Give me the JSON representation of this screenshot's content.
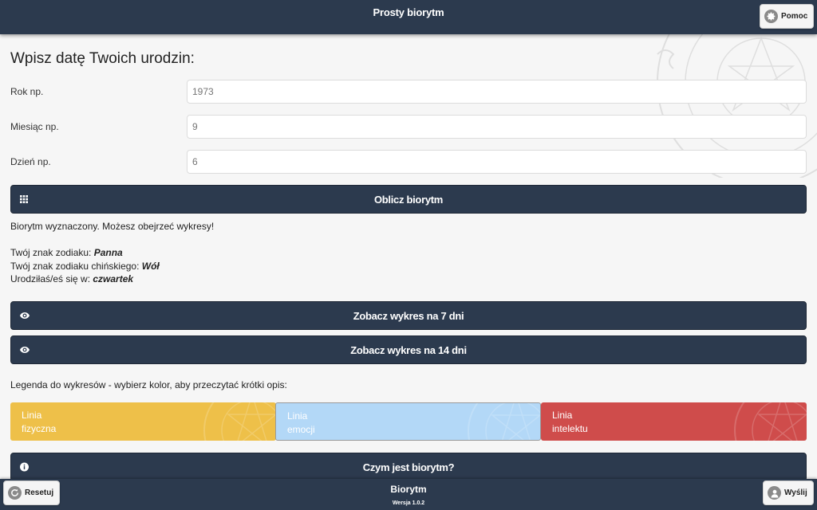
{
  "header": {
    "title": "Prosty biorytm",
    "help_label": "Pomoc",
    "help_icon": "gear-icon"
  },
  "form": {
    "title": "Wpisz datę Twoich urodzin:",
    "year_label": "Rok np.",
    "year_placeholder": "1973",
    "month_label": "Miesiąc np.",
    "month_placeholder": "9",
    "day_label": "Dzień np.",
    "day_placeholder": "6",
    "calculate_label": "Oblicz biorytm",
    "calculate_icon": "grid-icon"
  },
  "result": {
    "status": "Biorytm wyznaczony. Możesz obejrzeć wykresy!",
    "zodiac_label": "Twój znak zodiaku: ",
    "zodiac_value": "Panna",
    "chinese_label": "Twój znak zodiaku chińskiego: ",
    "chinese_value": "Wół",
    "weekday_label": "Urodziłaś/eś się w: ",
    "weekday_value": "czwartek"
  },
  "charts": {
    "week_label": "Zobacz wykres na 7 dni",
    "two_weeks_label": "Zobacz wykres na 14 dni",
    "icon": "eye-icon"
  },
  "legend": {
    "intro": "Legenda do wykresów - wybierz kolor, aby przeczytać krótki opis:",
    "physical": {
      "line1": "Linia",
      "line2": "fizyczna",
      "color": "#eec049"
    },
    "emotional": {
      "line1": "Linia",
      "line2": "emocji",
      "color": "#b3d8f7"
    },
    "intellectual": {
      "line1": "Linia",
      "line2": "intelektu",
      "color": "#cf4c4b"
    }
  },
  "about": {
    "label": "Czym jest biorytm?",
    "icon": "info-icon"
  },
  "footer": {
    "title": "Biorytm",
    "version": "Wersja 1.0.2",
    "reset_label": "Resetuj",
    "reset_icon": "refresh-icon",
    "send_label": "Wyślij",
    "send_icon": "user-icon"
  },
  "colors": {
    "primary": "#2c3a4e",
    "background": "#f6f6f6"
  }
}
